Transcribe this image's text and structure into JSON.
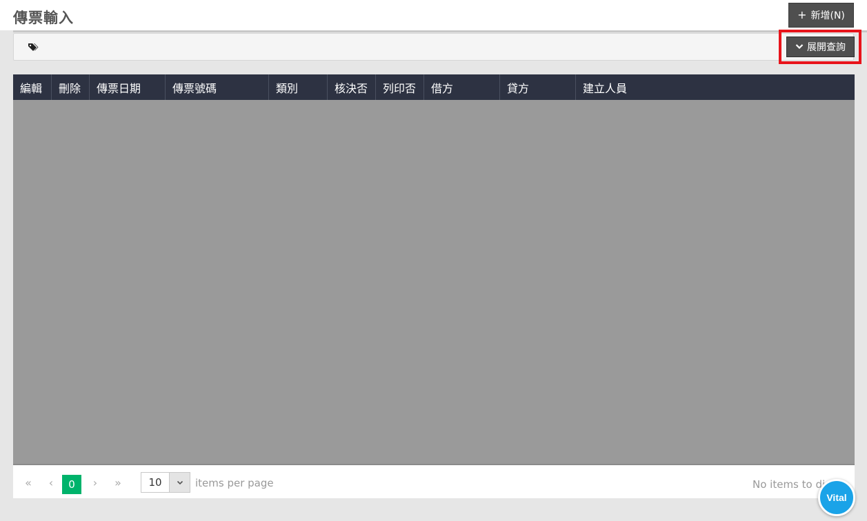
{
  "header": {
    "title": "傳票輸入",
    "add_button_label": "新增(N)",
    "add_button_icon": "plus-icon"
  },
  "filter": {
    "tags_icon": "tags-icon",
    "expand_button_label": "展開查詢",
    "expand_button_icon": "chevron-down-icon",
    "highlight_color": "#e8141b"
  },
  "grid": {
    "columns": [
      "編輯",
      "刪除",
      "傳票日期",
      "傳票號碼",
      "類別",
      "核決否",
      "列印否",
      "借方",
      "貸方",
      "建立人員"
    ],
    "rows": [],
    "header_bg": "#2d3242",
    "body_bg": "#9a9a9a"
  },
  "pager": {
    "current_page": "0",
    "page_size": "10",
    "items_per_page_label": "items per page",
    "status_text": "No items to display",
    "active_color": "#00b36b"
  },
  "badge": {
    "label": "Vital",
    "color": "#1aa3e8"
  }
}
